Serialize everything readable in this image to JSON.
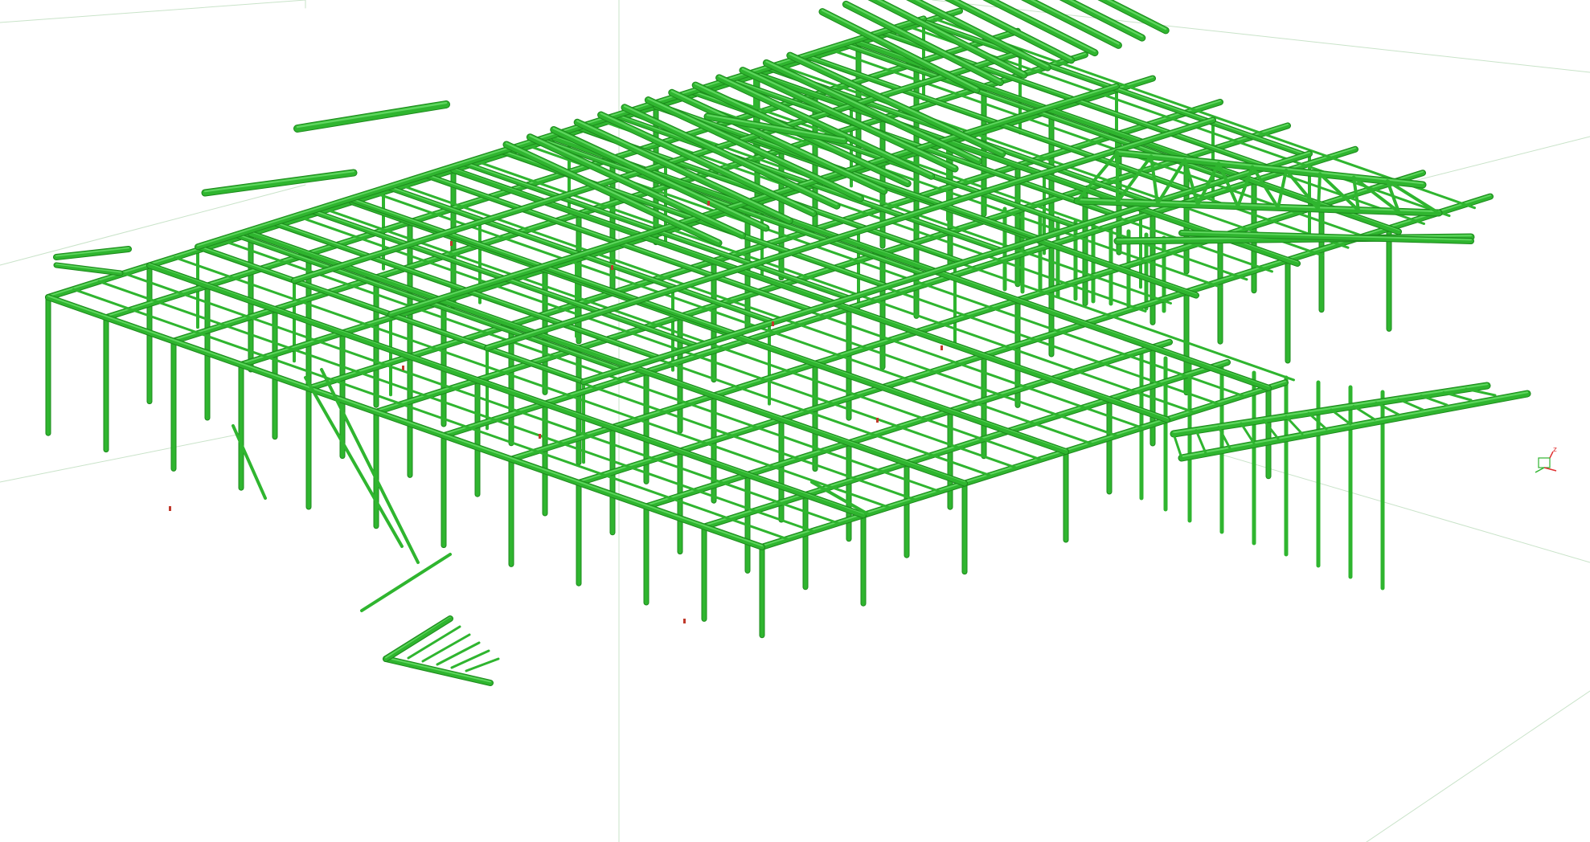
{
  "viewport": {
    "background": "#ffffff",
    "content": "3d-steel-structure-model"
  },
  "model": {
    "member_color": "#2fb52f",
    "member_color_dark": "#1d8a1d",
    "member_color_light": "#5fd65f",
    "connection_color": "#c0392b",
    "ground_grid_color": "#c9e3c9"
  },
  "axis_triad": {
    "z_label": "z",
    "x_color": "#e03030",
    "y_color": "#2fb52f",
    "z_color": "#e03030"
  }
}
